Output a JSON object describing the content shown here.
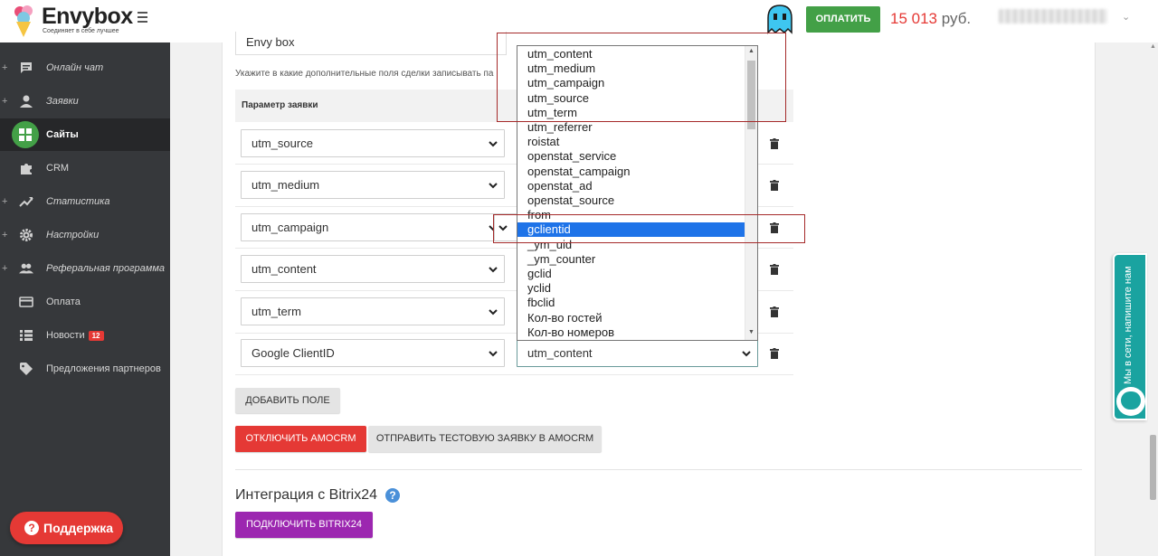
{
  "header": {
    "logo_text": "Envybox",
    "logo_tagline": "Соединяет в себе лучшее",
    "pay_button": "ОПЛАТИТЬ",
    "balance_amount": "15 013",
    "balance_currency": "руб.",
    "accent_green": "#43a047"
  },
  "sidebar": {
    "items": [
      {
        "label": "Онлайн чат",
        "icon": "chat-icon",
        "expandable": true
      },
      {
        "label": "Заявки",
        "icon": "person-icon",
        "expandable": true
      },
      {
        "label": "Сайты",
        "icon": "sites-grid-icon",
        "expandable": false,
        "active": true
      },
      {
        "label": "CRM",
        "icon": "puzzle-icon",
        "expandable": false
      },
      {
        "label": "Статистика",
        "icon": "trend-chart-icon",
        "expandable": true
      },
      {
        "label": "Настройки",
        "icon": "gear-icon",
        "expandable": true
      },
      {
        "label": "Реферальная программа",
        "icon": "people-icon",
        "expandable": true
      },
      {
        "label": "Оплата",
        "icon": "credit-card-icon",
        "expandable": false
      },
      {
        "label": "Новости",
        "icon": "list-icon",
        "expandable": false,
        "badge": "12"
      },
      {
        "label": "Предложения партнеров",
        "icon": "tag-icon",
        "expandable": false
      }
    ],
    "support_button": "Поддержка"
  },
  "main": {
    "top_input_value": "Envy box",
    "hint": "Укажите в какие дополнительные поля сделки записывать па",
    "table_header": "Параметр заявки",
    "rows": [
      {
        "param": "utm_source"
      },
      {
        "param": "utm_medium"
      },
      {
        "param": "utm_campaign"
      },
      {
        "param": "utm_content"
      },
      {
        "param": "utm_term"
      },
      {
        "param": "Google ClientID",
        "field": "utm_content"
      }
    ],
    "add_field_button": "ДОБАВИТЬ ПОЛЕ",
    "disable_amocrm_button": "ОТКЛЮЧИТЬ AMOCRM",
    "send_test_button": "ОТПРАВИТЬ ТЕСТОВУЮ ЗАЯВКУ В AMOCRM",
    "bitrix_title": "Интеграция с Bitrix24",
    "connect_bitrix_button": "ПОДКЛЮЧИТЬ BITRIX24"
  },
  "dropdown": {
    "options": [
      "utm_content",
      "utm_medium",
      "utm_campaign",
      "utm_source",
      "utm_term",
      "utm_referrer",
      "roistat",
      "openstat_service",
      "openstat_campaign",
      "openstat_ad",
      "openstat_source",
      "from",
      "gclientid",
      "_ym_uid",
      "_ym_counter",
      "gclid",
      "yclid",
      "fbclid",
      "Кол-во гостей",
      "Кол-во номеров"
    ],
    "selected": "gclientid",
    "selected_color": "#1e73e8"
  },
  "chat_widget": {
    "text": "Мы в сети, напишите нам",
    "color": "#1aa3a0"
  }
}
